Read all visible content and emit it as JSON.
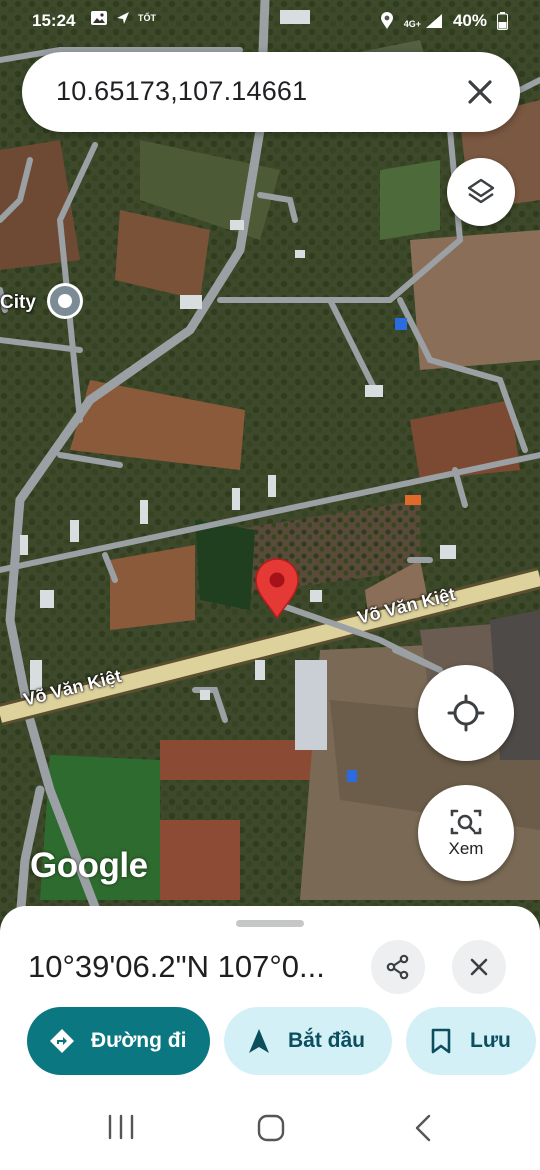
{
  "status_bar": {
    "time": "15:24",
    "small_tag": "TỐT",
    "network": "4G+",
    "battery": "40%"
  },
  "search": {
    "query": "10.65173,107.14661"
  },
  "map": {
    "road_label": "Võ Văn Kiệt",
    "place_label": "City",
    "attribution": "Google"
  },
  "lens": {
    "label": "Xem"
  },
  "sheet": {
    "title": "10°39'06.2\"N 107°0..."
  },
  "actions": {
    "directions": "Đường đi",
    "start": "Bắt đầu",
    "save": "Lưu"
  },
  "colors": {
    "accent_teal": "#0b7780",
    "tonal_bg": "#d4f0f7",
    "pin_red": "#e53935"
  },
  "icons": [
    "image-icon",
    "send-icon",
    "location-icon",
    "signal-icon",
    "battery-icon",
    "close-icon",
    "layers-icon",
    "my-location-icon",
    "lens-icon",
    "share-icon",
    "directions-icon",
    "navigation-icon",
    "bookmark-icon",
    "recents-icon",
    "home-icon",
    "back-icon"
  ]
}
